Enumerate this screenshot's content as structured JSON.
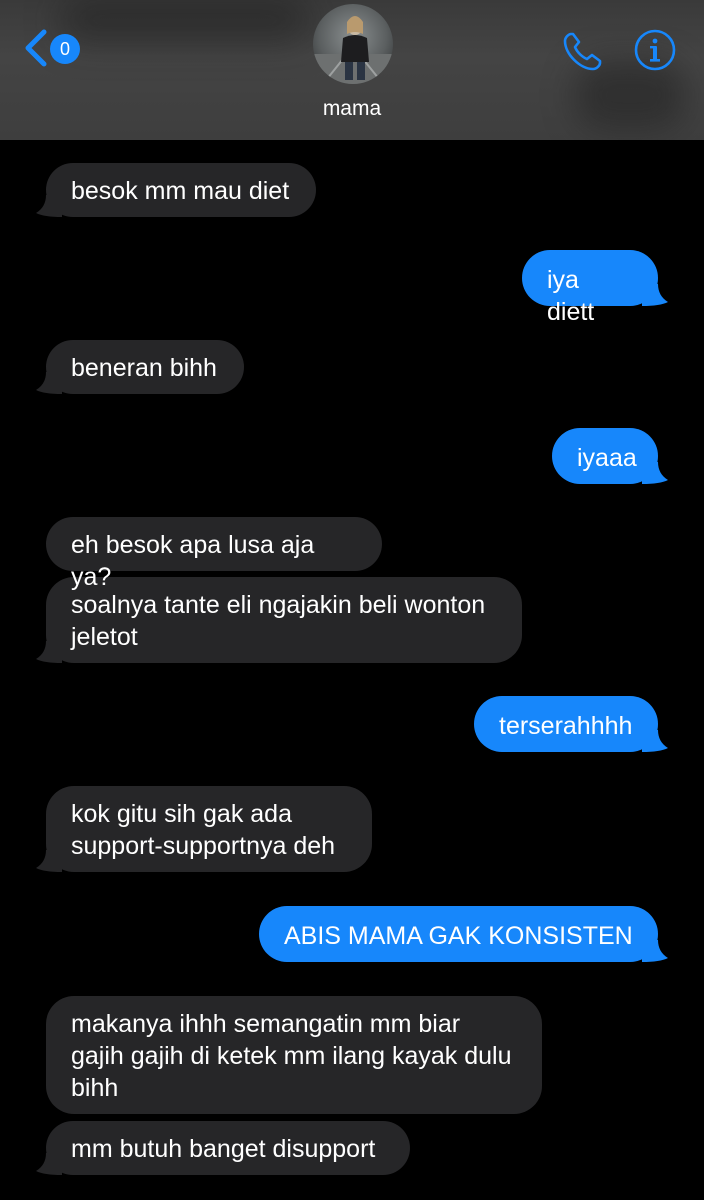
{
  "header": {
    "back_badge_count": "0",
    "contact_name": "mama",
    "accent_color": "#1787fb"
  },
  "messages": [
    {
      "from": "them",
      "text": "besok mm mau diet"
    },
    {
      "from": "me",
      "text": "iya diett"
    },
    {
      "from": "them",
      "text": "beneran bihh"
    },
    {
      "from": "me",
      "text": "iyaaa"
    },
    {
      "from": "them",
      "text": "eh besok apa lusa aja ya?"
    },
    {
      "from": "them",
      "text": "soalnya tante eli ngajakin beli wonton jeletot"
    },
    {
      "from": "me",
      "text": "terserahhhh"
    },
    {
      "from": "them",
      "text": "kok gitu sih gak ada support-supportnya deh"
    },
    {
      "from": "me",
      "text": "ABIS MAMA GAK KONSISTEN"
    },
    {
      "from": "them",
      "text": "makanya ihhh semangatin mm biar gajih gajih di ketek mm ilang kayak dulu bihh"
    },
    {
      "from": "them",
      "text": "mm butuh banget disupport"
    }
  ],
  "colors": {
    "incoming_bubble": "#262628",
    "outgoing_bubble": "#1787fb",
    "background": "#000000"
  },
  "icons": {
    "back": "chevron-left-icon",
    "call": "phone-icon",
    "info": "info-icon"
  }
}
